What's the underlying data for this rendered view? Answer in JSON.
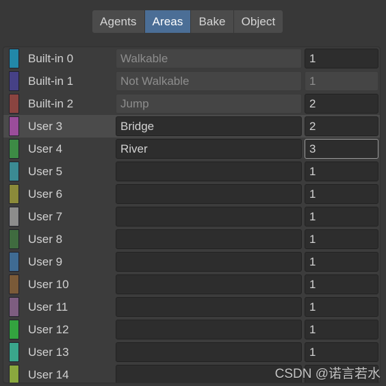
{
  "tabs": [
    {
      "label": "Agents",
      "selected": false
    },
    {
      "label": "Areas",
      "selected": true
    },
    {
      "label": "Bake",
      "selected": false
    },
    {
      "label": "Object",
      "selected": false
    }
  ],
  "colors": {
    "tab_selected_bg": "#4b6e96",
    "tab_bg": "#4b4b4b",
    "panel_bg": "#3c3c3c",
    "row_selected_bg": "#4b4b4b",
    "field_bg": "#2d2d2d",
    "field_disabled_bg": "#454545",
    "text": "#d2d2d2",
    "text_disabled": "#8d8d8d",
    "focus_border": "#9a9a9a"
  },
  "rows": [
    {
      "label": "Built-in 0",
      "swatch": "#2288a8",
      "name": "Walkable",
      "cost": "1",
      "builtin": true,
      "name_disabled": true,
      "cost_disabled": false,
      "selected": false,
      "cost_focused": false
    },
    {
      "label": "Built-in 1",
      "swatch": "#464186",
      "name": "Not Walkable",
      "cost": "1",
      "builtin": true,
      "name_disabled": true,
      "cost_disabled": true,
      "selected": false,
      "cost_focused": false
    },
    {
      "label": "Built-in 2",
      "swatch": "#8a4440",
      "name": "Jump",
      "cost": "2",
      "builtin": true,
      "name_disabled": true,
      "cost_disabled": false,
      "selected": false,
      "cost_focused": false
    },
    {
      "label": "User 3",
      "swatch": "#9a4d9a",
      "name": "Bridge",
      "cost": "2",
      "builtin": false,
      "name_disabled": false,
      "cost_disabled": false,
      "selected": true,
      "cost_focused": false
    },
    {
      "label": "User 4",
      "swatch": "#3d8b45",
      "name": "River",
      "cost": "3",
      "builtin": false,
      "name_disabled": false,
      "cost_disabled": false,
      "selected": false,
      "cost_focused": true
    },
    {
      "label": "User 5",
      "swatch": "#3b8a93",
      "name": "",
      "cost": "1",
      "builtin": false,
      "name_disabled": false,
      "cost_disabled": false,
      "selected": false,
      "cost_focused": false
    },
    {
      "label": "User 6",
      "swatch": "#8b8a3a",
      "name": "",
      "cost": "1",
      "builtin": false,
      "name_disabled": false,
      "cost_disabled": false,
      "selected": false,
      "cost_focused": false
    },
    {
      "label": "User 7",
      "swatch": "#8c8c8c",
      "name": "",
      "cost": "1",
      "builtin": false,
      "name_disabled": false,
      "cost_disabled": false,
      "selected": false,
      "cost_focused": false
    },
    {
      "label": "User 8",
      "swatch": "#3f6b3f",
      "name": "",
      "cost": "1",
      "builtin": false,
      "name_disabled": false,
      "cost_disabled": false,
      "selected": false,
      "cost_focused": false
    },
    {
      "label": "User 9",
      "swatch": "#3f6b93",
      "name": "",
      "cost": "1",
      "builtin": false,
      "name_disabled": false,
      "cost_disabled": false,
      "selected": false,
      "cost_focused": false
    },
    {
      "label": "User 10",
      "swatch": "#7a5a38",
      "name": "",
      "cost": "1",
      "builtin": false,
      "name_disabled": false,
      "cost_disabled": false,
      "selected": false,
      "cost_focused": false
    },
    {
      "label": "User 11",
      "swatch": "#7d5d80",
      "name": "",
      "cost": "1",
      "builtin": false,
      "name_disabled": false,
      "cost_disabled": false,
      "selected": false,
      "cost_focused": false
    },
    {
      "label": "User 12",
      "swatch": "#33a33f",
      "name": "",
      "cost": "1",
      "builtin": false,
      "name_disabled": false,
      "cost_disabled": false,
      "selected": false,
      "cost_focused": false
    },
    {
      "label": "User 13",
      "swatch": "#3aa68c",
      "name": "",
      "cost": "1",
      "builtin": false,
      "name_disabled": false,
      "cost_disabled": false,
      "selected": false,
      "cost_focused": false
    },
    {
      "label": "User 14",
      "swatch": "#8aa83e",
      "name": "",
      "cost": "",
      "builtin": false,
      "name_disabled": false,
      "cost_disabled": false,
      "selected": false,
      "cost_focused": false
    }
  ],
  "watermark": {
    "text": "CSDN @诺言若水"
  }
}
